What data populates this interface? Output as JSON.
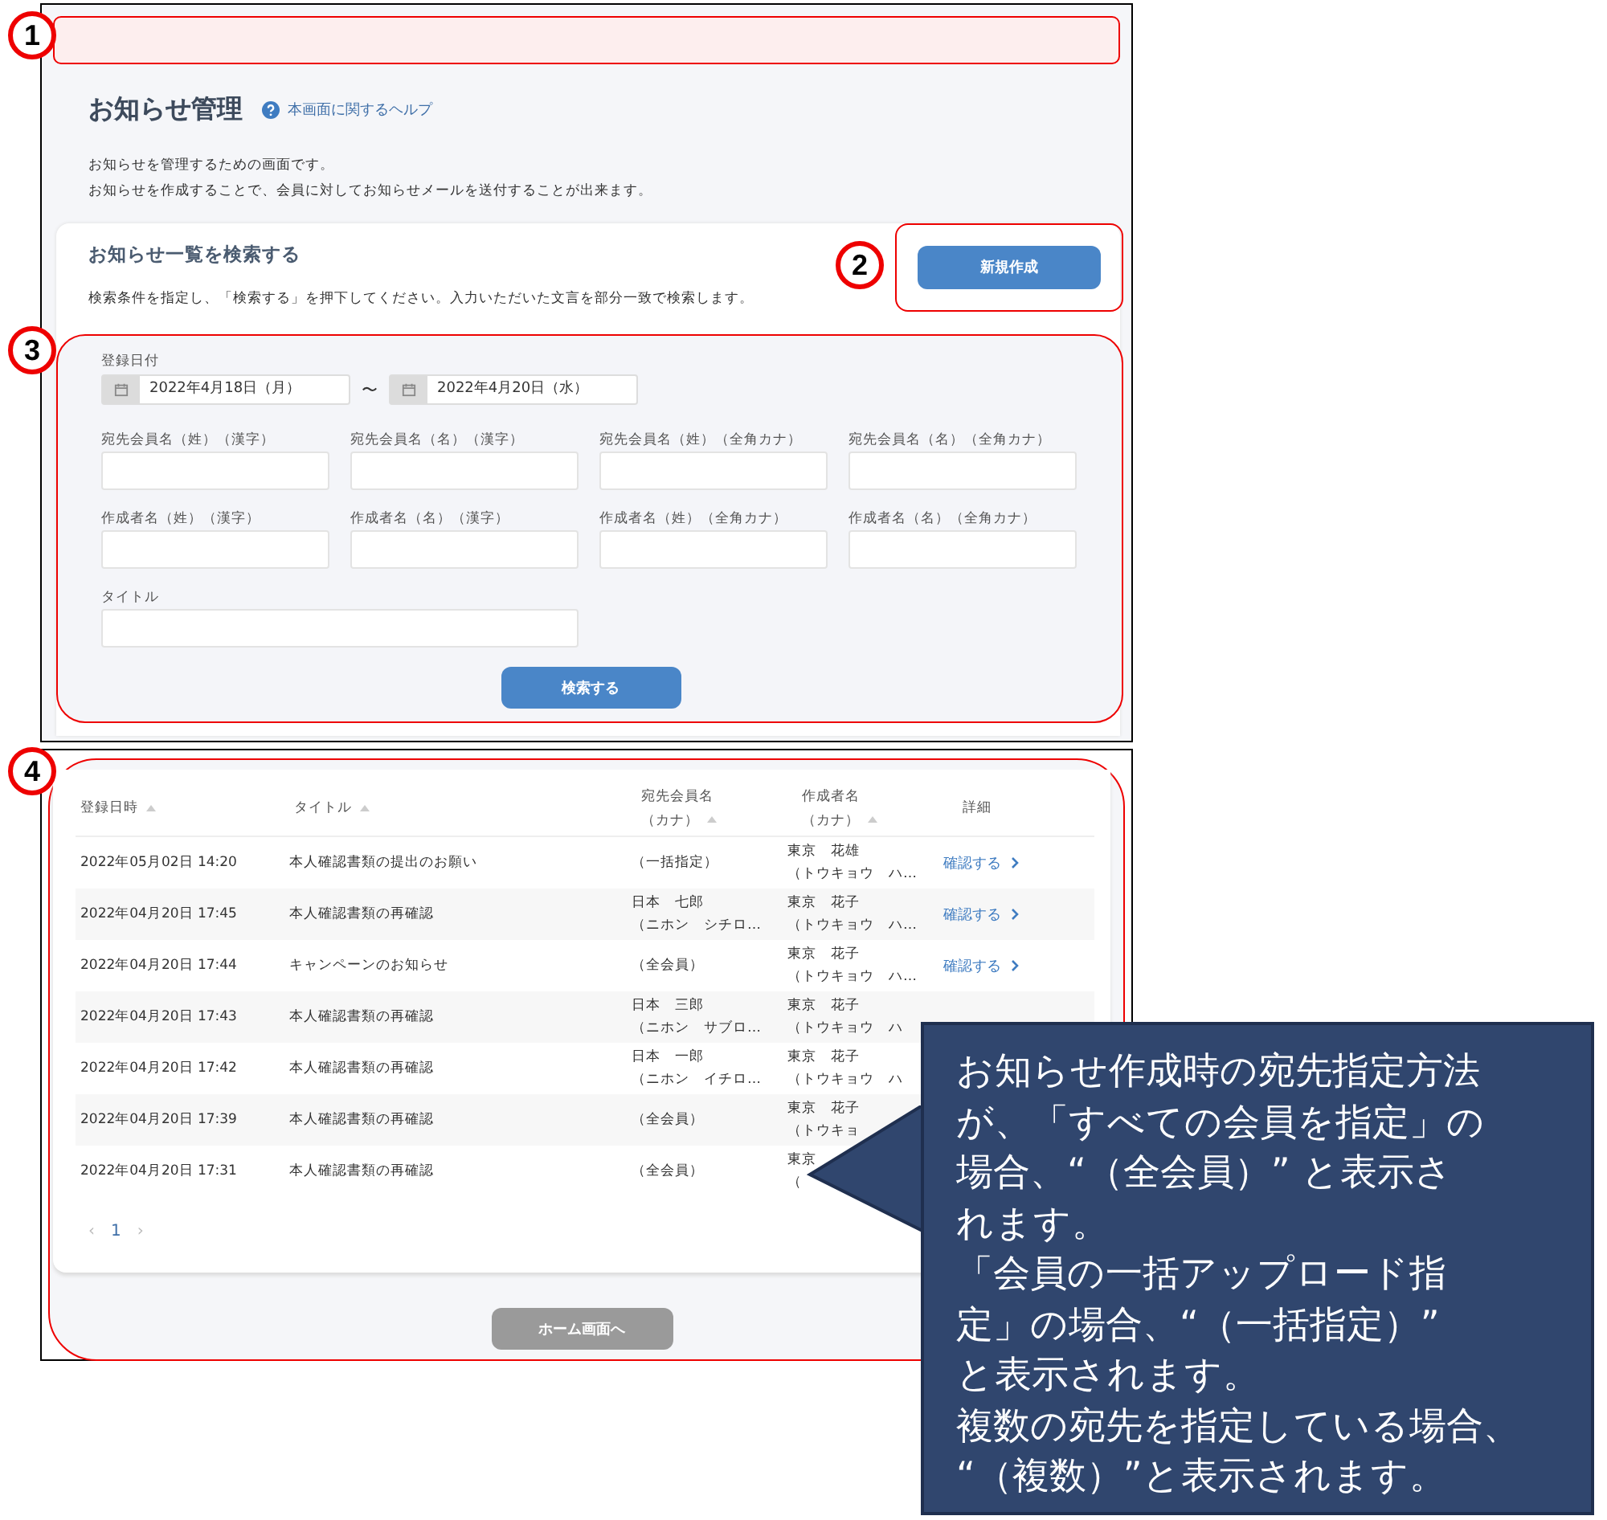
{
  "notice_bar": {
    "marker": "1"
  },
  "page": {
    "title": "お知らせ管理",
    "help_link": "本画面に関するヘルプ",
    "description": [
      "お知らせを管理するための画面です。",
      "お知らせを作成することで、会員に対してお知らせメールを送付することが出来ます。"
    ]
  },
  "search": {
    "title": "お知らせ一覧を検索する",
    "instructions": "検索条件を指定し、「検索する」を押下してください。入力いただいた文言を部分一致で検索します。",
    "new_button": "新規作成",
    "new_marker": "2",
    "marker": "3",
    "date_label": "登録日付",
    "date_from": "2022年4月18日（月）",
    "date_separator": "〜",
    "date_to": "2022年4月20日（水）",
    "fields": [
      {
        "label": "宛先会員名（姓）（漢字）"
      },
      {
        "label": "宛先会員名（名）（漢字）"
      },
      {
        "label": "宛先会員名（姓）（全角カナ）"
      },
      {
        "label": "宛先会員名（名）（全角カナ）"
      },
      {
        "label": "作成者名（姓）（漢字）"
      },
      {
        "label": "作成者名（名）（漢字）"
      },
      {
        "label": "作成者名（姓）（全角カナ）"
      },
      {
        "label": "作成者名（名）（全角カナ）"
      },
      {
        "label": "タイトル"
      }
    ],
    "search_button": "検索する"
  },
  "results": {
    "marker": "4",
    "columns": [
      {
        "label": "登録日時",
        "sortable": true
      },
      {
        "label": "タイトル",
        "sortable": true
      },
      {
        "label": "宛先会員名",
        "sub": "（カナ）",
        "sortable": true
      },
      {
        "label": "作成者名",
        "sub": "（カナ）",
        "sortable": true
      },
      {
        "label": "詳細",
        "sortable": false
      }
    ],
    "rows": [
      {
        "date": "2022年05月02日 14:20",
        "title": "本人確認書類の提出のお願い",
        "recipient": "（一括指定）",
        "creator": "東京　花雄",
        "creator_kana": "（トウキョウ　ハ…",
        "detail_link": "確認する"
      },
      {
        "date": "2022年04月20日 17:45",
        "title": "本人確認書類の再確認",
        "recipient": "日本　七郎",
        "recipient_kana": "（ニホン　シチロ…",
        "creator": "東京　花子",
        "creator_kana": "（トウキョウ　ハ…",
        "detail_link": "確認する"
      },
      {
        "date": "2022年04月20日 17:44",
        "title": "キャンペーンのお知らせ",
        "recipient": "（全会員）",
        "creator": "東京　花子",
        "creator_kana": "（トウキョウ　ハ…",
        "detail_link": "確認する"
      },
      {
        "date": "2022年04月20日 17:43",
        "title": "本人確認書類の再確認",
        "recipient": "日本　三郎",
        "recipient_kana": "（ニホン　サブロ…",
        "creator": "東京　花子",
        "creator_kana": "（トウキョウ　ハ"
      },
      {
        "date": "2022年04月20日 17:42",
        "title": "本人確認書類の再確認",
        "recipient": "日本　一郎",
        "recipient_kana": "（ニホン　イチロ…",
        "creator": "東京　花子",
        "creator_kana": "（トウキョウ　ハ"
      },
      {
        "date": "2022年04月20日 17:39",
        "title": "本人確認書類の再確認",
        "recipient": "（全会員）",
        "creator": "東京　花子",
        "creator_kana": "（トウキョ"
      },
      {
        "date": "2022年04月20日 17:31",
        "title": "本人確認書類の再確認",
        "recipient": "（全会員）",
        "creator": "東京",
        "creator_kana": "（"
      }
    ],
    "pagination": {
      "prev": "‹",
      "page": "1",
      "next": "›"
    }
  },
  "home_button": "ホーム画面へ",
  "callout": [
    "お知らせ作成時の宛先指定方法",
    "が、「すべての会員を指定」の",
    "場合、“（全会員）” と表示さ",
    "れます。",
    "「会員の一括アップロード指",
    "定」の場合、“（一括指定）”",
    "と表示されます。",
    "複数の宛先を指定している場合、",
    "“（複数）”と表示されます。"
  ]
}
